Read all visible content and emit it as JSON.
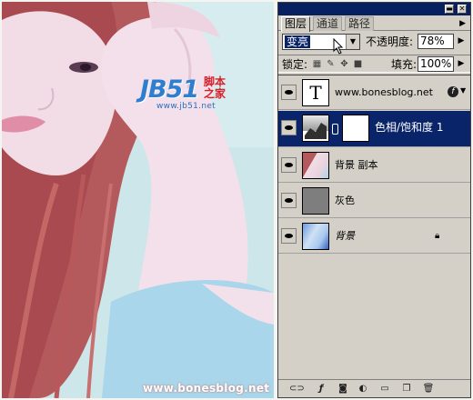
{
  "panel": {
    "tabs": [
      {
        "label": "图层",
        "active": true
      },
      {
        "label": "通道",
        "active": false
      },
      {
        "label": "路径",
        "active": false
      }
    ],
    "blend_mode": "变亮",
    "opacity_label": "不透明度:",
    "opacity_value": "78%",
    "lock_label": "锁定:",
    "fill_label": "填充:",
    "fill_value": "100%",
    "layers": [
      {
        "name": "www.bonesblog.net",
        "type": "text",
        "visible": true,
        "selected": false
      },
      {
        "name": "色相/饱和度 1",
        "type": "adjustment",
        "visible": true,
        "selected": true
      },
      {
        "name": "背景 副本",
        "type": "image",
        "visible": true,
        "selected": false
      },
      {
        "name": "灰色",
        "type": "fill-gray",
        "visible": true,
        "selected": false
      },
      {
        "name": "背景",
        "type": "image",
        "visible": true,
        "selected": false,
        "locked": true
      }
    ],
    "text_thumb_glyph": "T"
  },
  "watermark": {
    "logo_text": "JB51",
    "logo_cn_line1": "脚本",
    "logo_cn_line2": "之家",
    "logo_url": "www.jb51.net",
    "bottom_url": "www.bonesblog.net"
  },
  "colors": {
    "selection": "#0a246a",
    "panel_bg": "#d4d0c8",
    "photo_bg": "#cfe6ea",
    "hair": "#b0504f",
    "skin": "#f1dbe6"
  }
}
